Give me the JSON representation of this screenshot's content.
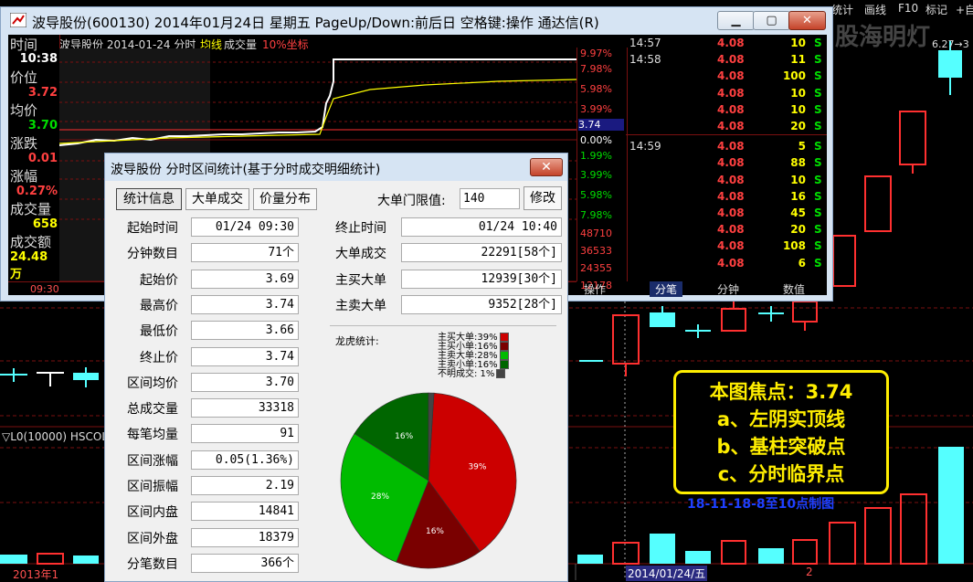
{
  "background": {
    "toplinks": [
      "统计",
      "画线",
      "F10",
      "标记",
      "+自"
    ],
    "watermark": "股海明灯",
    "price_tag": "6.27→3",
    "indicator_label": "▽L0(10000) HSCOL",
    "bottom_date_left": "2013年1",
    "bottom_date_mid": "2014/01/24/五",
    "bottom_right_num": "2",
    "focus": {
      "line1": "本图焦点：3.74",
      "line2": "a、左阴实顶线",
      "line3": "b、基柱突破点",
      "line4": "c、分时临界点"
    },
    "caption": "18-11-18-8至10点制图"
  },
  "window": {
    "title": "波导股份(600130) 2014年01月24日 星期五 PageUp/Down:前后日 空格键:操作 通达信(R)",
    "chart_header": "波导股份  2014-01-24 分时",
    "legend_avg": "均线",
    "legend_vol": "成交量",
    "legend_coord": "10%坐标",
    "left_panel": {
      "time_label": "时间",
      "time_value": "10:38",
      "price_label": "价位",
      "price_value": "3.72",
      "avg_label": "均价",
      "avg_value": "3.70",
      "change_label": "涨跌",
      "change_value": "0.01",
      "pct_label": "涨幅",
      "pct_value": "0.27%",
      "vol_label": "成交量",
      "vol_value": "658",
      "amt_label": "成交额",
      "amt_value": "24.48万"
    },
    "right_axis": [
      "9.97%",
      "7.98%",
      "5.98%",
      "3.99%",
      "3.74",
      "0.00%",
      "1.99%",
      "3.99%",
      "5.98%",
      "7.98%",
      "48710",
      "36533",
      "24355",
      "12178"
    ],
    "x_start": "09:30",
    "ticks": [
      {
        "time": "14:57",
        "price": "4.08",
        "vol": "10",
        "bs": "S"
      },
      {
        "time": "14:58",
        "price": "4.08",
        "vol": "11",
        "bs": "S"
      },
      {
        "time": "",
        "price": "4.08",
        "vol": "100",
        "bs": "S"
      },
      {
        "time": "",
        "price": "4.08",
        "vol": "10",
        "bs": "S"
      },
      {
        "time": "",
        "price": "4.08",
        "vol": "10",
        "bs": "S"
      },
      {
        "time": "",
        "price": "4.08",
        "vol": "20",
        "bs": "S"
      },
      {
        "time": "14:59",
        "price": "4.08",
        "vol": "5",
        "bs": "S"
      },
      {
        "time": "",
        "price": "4.08",
        "vol": "88",
        "bs": "S"
      },
      {
        "time": "",
        "price": "4.08",
        "vol": "10",
        "bs": "S"
      },
      {
        "time": "",
        "price": "4.08",
        "vol": "16",
        "bs": "S"
      },
      {
        "time": "",
        "price": "4.08",
        "vol": "45",
        "bs": "S"
      },
      {
        "time": "",
        "price": "4.08",
        "vol": "20",
        "bs": "S"
      },
      {
        "time": "",
        "price": "4.08",
        "vol": "108",
        "bs": "S"
      },
      {
        "time": "",
        "price": "4.08",
        "vol": "6",
        "bs": "S"
      }
    ],
    "tick_tabs": [
      "操作",
      "分笔",
      "分钟",
      "数值"
    ]
  },
  "dialog": {
    "title": "波导股份 分时区间统计(基于分时成交明细统计)",
    "tabs": [
      "统计信息",
      "大单成交",
      "价量分布"
    ],
    "threshold_label": "大单门限值:",
    "threshold_value": "140",
    "modify_button": "修改",
    "left_rows": [
      {
        "label": "起始时间",
        "value": "01/24 09:30"
      },
      {
        "label": "分钟数目",
        "value": "71个"
      },
      {
        "label": "起始价",
        "value": "3.69"
      },
      {
        "label": "最高价",
        "value": "3.74"
      },
      {
        "label": "最低价",
        "value": "3.66"
      },
      {
        "label": "终止价",
        "value": "3.74"
      },
      {
        "label": "区间均价",
        "value": "3.70"
      },
      {
        "label": "总成交量",
        "value": "33318"
      },
      {
        "label": "每笔均量",
        "value": "91"
      },
      {
        "label": "区间涨幅",
        "value": "0.05(1.36%)"
      },
      {
        "label": "区间振幅",
        "value": "2.19"
      },
      {
        "label": "区间内盘",
        "value": "14841"
      },
      {
        "label": "区间外盘",
        "value": "18379"
      },
      {
        "label": "分笔数目",
        "value": "366个"
      }
    ],
    "right_rows": [
      {
        "label": "终止时间",
        "value": "01/24 10:40"
      },
      {
        "label": "大单成交",
        "value": "22291[58个]"
      },
      {
        "label": "主买大单",
        "value": "12939[30个]"
      },
      {
        "label": "主卖大单",
        "value": "9352[28个]"
      }
    ],
    "pie_title": "龙虎统计:",
    "pie_legend": [
      {
        "label": "主买大单:39%",
        "color": "#cc0000"
      },
      {
        "label": "主买小单:16%",
        "color": "#7a0000"
      },
      {
        "label": "主卖大单:28%",
        "color": "#00bb00"
      },
      {
        "label": "主卖小单:16%",
        "color": "#006600"
      },
      {
        "label": "不明成交: 1%",
        "color": "#444444"
      }
    ],
    "pie_labels": [
      "39%",
      "16%",
      "28%",
      "16%"
    ]
  }
}
